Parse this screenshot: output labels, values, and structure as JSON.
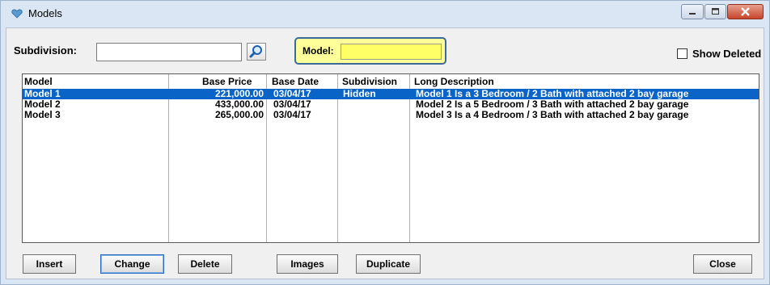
{
  "window": {
    "title": "Models"
  },
  "filters": {
    "subdivision_label": "Subdivision:",
    "subdivision_value": "",
    "model_label": "Model:",
    "model_value": "",
    "show_deleted_label": "Show Deleted",
    "show_deleted_checked": false
  },
  "table": {
    "columns": [
      "Model",
      "Base Price",
      "Base Date",
      "Subdivision",
      "Long Description"
    ],
    "rows": [
      {
        "model": "Model 1",
        "base_price": "221,000.00",
        "base_date": "03/04/17",
        "subdivision": "Hidden",
        "description": "Model 1 Is a 3 Bedroom / 2 Bath with attached 2 bay garage",
        "selected": true
      },
      {
        "model": "Model 2",
        "base_price": "433,000.00",
        "base_date": "03/04/17",
        "subdivision": "",
        "description": "Model 2 Is a 5 Bedroom / 3 Bath with attached 2 bay garage",
        "selected": false
      },
      {
        "model": "Model 3",
        "base_price": "265,000.00",
        "base_date": "03/04/17",
        "subdivision": "",
        "description": "Model 3 Is a 4 Bedroom / 3 Bath with attached 2 bay garage",
        "selected": false
      }
    ]
  },
  "buttons": {
    "insert": "Insert",
    "change": "Change",
    "delete": "Delete",
    "images": "Images",
    "duplicate": "Duplicate",
    "close": "Close"
  },
  "colors": {
    "selection": "#0a64c8",
    "model_highlight": "#ffff99",
    "titlebar": "#dbe6f4"
  },
  "icons": [
    "app-icon",
    "search-icon",
    "minimize-icon",
    "maximize-icon",
    "close-icon"
  ]
}
